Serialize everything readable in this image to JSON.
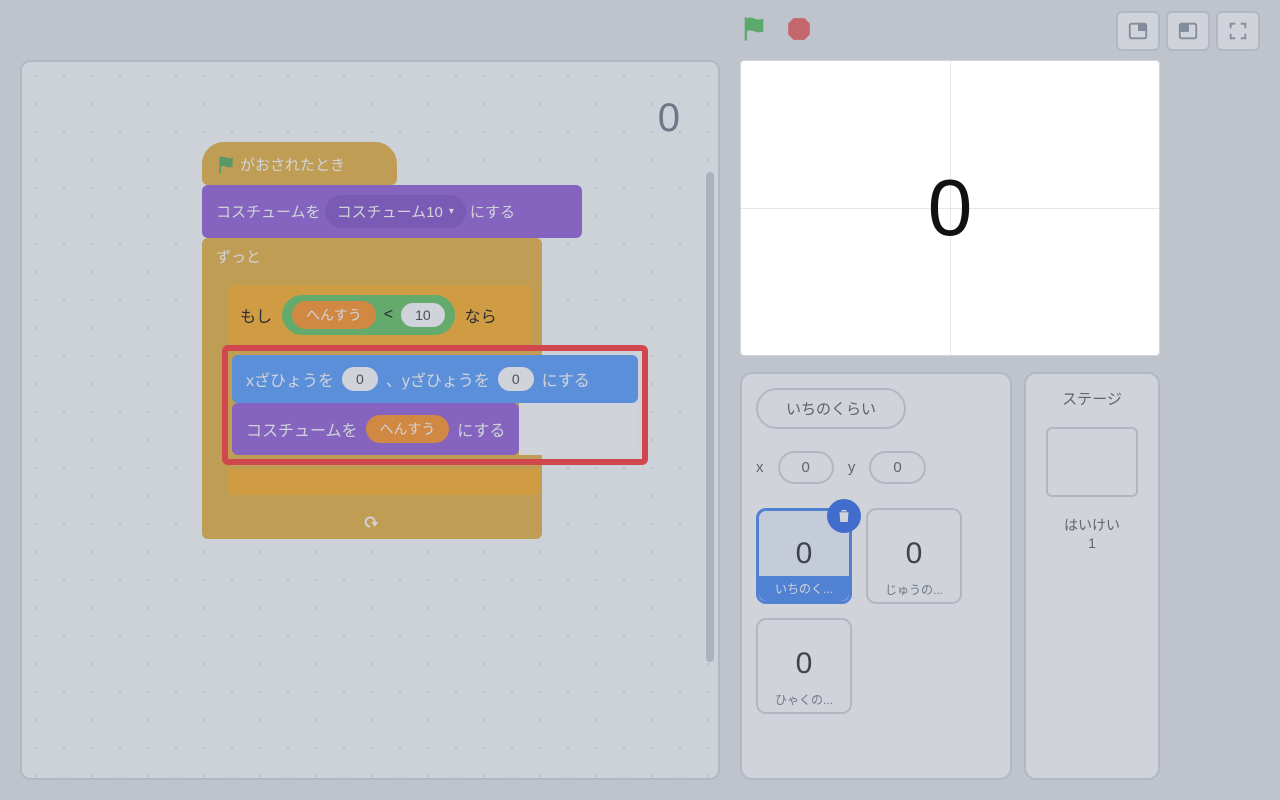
{
  "script_corner_value": "0",
  "blocks": {
    "hat_label": "がおされたとき",
    "set_costume_prefix": "コスチュームを",
    "set_costume_value": "コスチューム10",
    "set_costume_suffix": "にする",
    "forever_label": "ずっと",
    "if_prefix": "もし",
    "if_var": "へんすう",
    "if_op": "<",
    "if_rhs": "10",
    "if_suffix": "なら",
    "goto_x_prefix": "xざひょうを",
    "goto_x_val": "0",
    "goto_y_prefix": "、yざひょうを",
    "goto_y_val": "0",
    "goto_suffix": "にする",
    "sw_costume_prefix": "コスチュームを",
    "sw_costume_var": "へんすう",
    "sw_costume_suffix": "にする"
  },
  "stage_value": "0",
  "sprite_panel": {
    "name": "いちのくらい",
    "x_label": "x",
    "x_val": "0",
    "y_label": "y",
    "y_val": "0",
    "thumbs": [
      {
        "big": "0",
        "label": "いちのく...",
        "selected": true
      },
      {
        "big": "0",
        "label": "じゅうの...",
        "selected": false
      },
      {
        "big": "0",
        "label": "ひゃくの...",
        "selected": false
      }
    ]
  },
  "stage_side": {
    "title": "ステージ",
    "caption": "はいけい",
    "count": "1"
  }
}
